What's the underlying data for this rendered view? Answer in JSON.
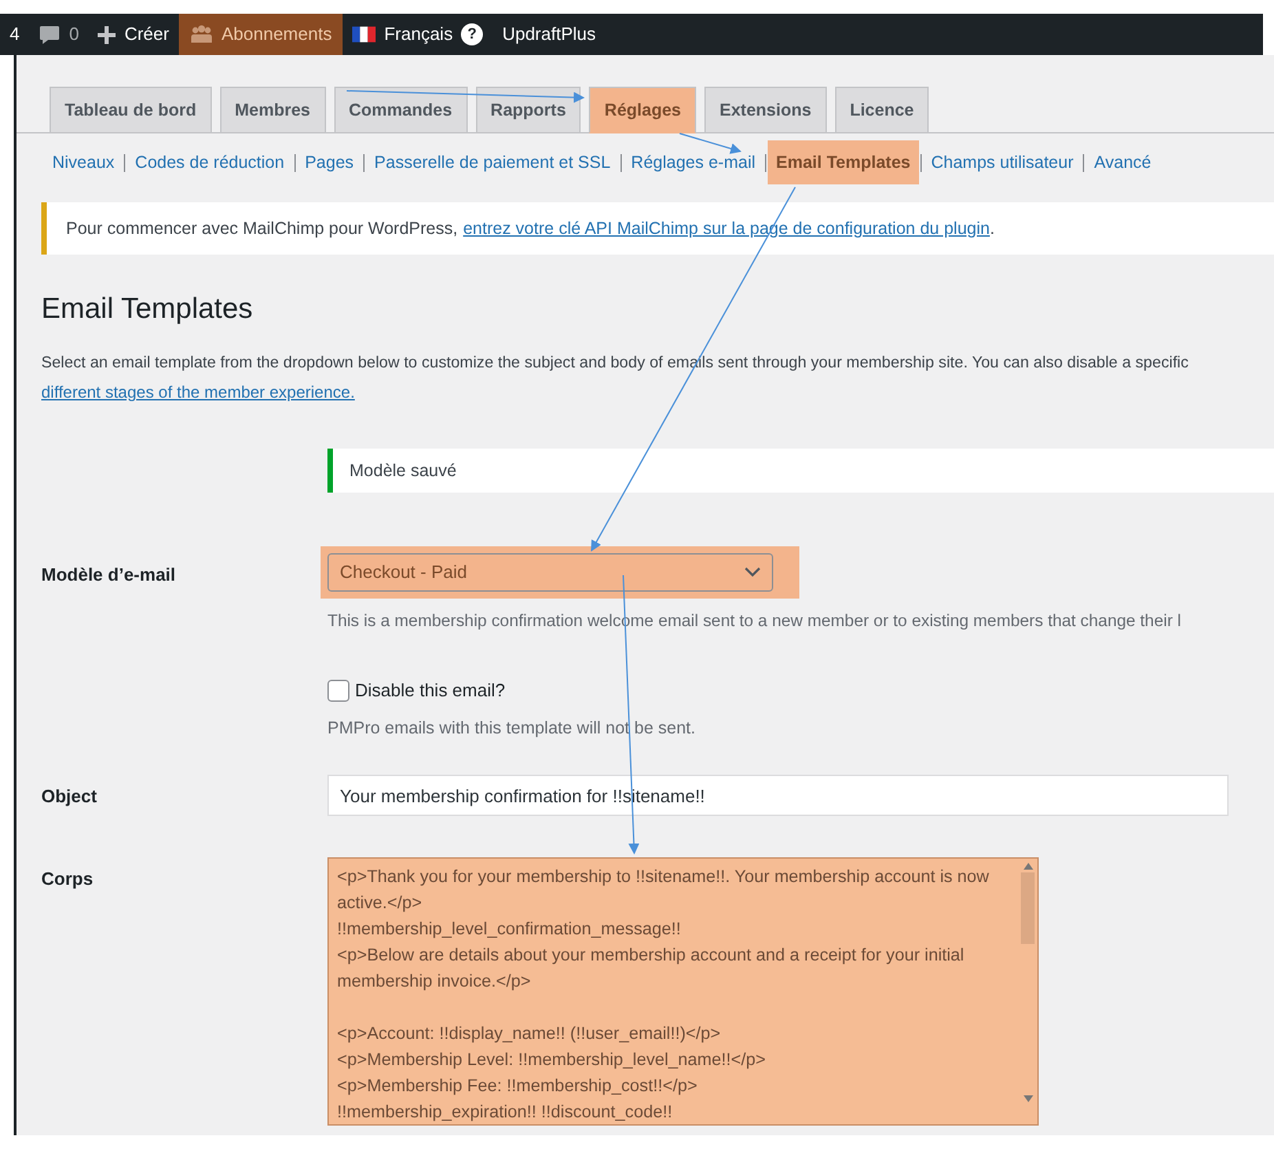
{
  "admin_bar": {
    "items": [
      {
        "kind": "text",
        "label": "4"
      },
      {
        "kind": "comments",
        "label": "0"
      },
      {
        "kind": "new",
        "label": "Créer"
      },
      {
        "kind": "members",
        "label": "Abonnements",
        "highlighted": true
      },
      {
        "kind": "language",
        "label": "Français",
        "help": "?"
      },
      {
        "kind": "text",
        "label": "UpdraftPlus"
      }
    ]
  },
  "tabs": [
    {
      "label": "Tableau de bord",
      "selected": false
    },
    {
      "label": "Membres",
      "selected": false
    },
    {
      "label": "Commandes",
      "selected": false
    },
    {
      "label": "Rapports",
      "selected": false
    },
    {
      "label": "Réglages",
      "selected": true,
      "highlighted": true
    },
    {
      "label": "Extensions",
      "selected": false
    },
    {
      "label": "Licence",
      "selected": false
    }
  ],
  "subnav": [
    {
      "label": "Niveaux",
      "selected": false
    },
    {
      "label": "Codes de réduction",
      "selected": false
    },
    {
      "label": "Pages",
      "selected": false
    },
    {
      "label": "Passerelle de paiement et SSL",
      "selected": false
    },
    {
      "label": "Réglages e-mail",
      "selected": false
    },
    {
      "label": "Email Templates",
      "selected": true,
      "highlighted": true
    },
    {
      "label": "Champs utilisateur",
      "selected": false
    },
    {
      "label": "Avancé",
      "selected": false
    }
  ],
  "notice": {
    "text": "Pour commencer avec MailChimp pour WordPress,",
    "link": "entrez votre clé API MailChimp sur la page de configuration du plugin ",
    "after": "."
  },
  "heading": "Email Templates",
  "description": {
    "text": "Select an email template from the dropdown below to customize the subject and body of emails sent through your membership site. You can also disable a specific",
    "link": "different stages of the member experience."
  },
  "saved_notice": "Modèle sauvé",
  "template": {
    "label": "Modèle d’e-mail",
    "value": "Checkout - Paid",
    "highlighted": true,
    "help": "This is a membership confirmation welcome email sent to a new member or to existing members that change their l"
  },
  "disable": {
    "label": "Disable this email?",
    "checked": false,
    "help": "PMPro emails with this template will not be sent."
  },
  "object": {
    "label": "Object",
    "value": "Your membership confirmation for !!sitename!!"
  },
  "body": {
    "label": "Corps",
    "highlighted": true,
    "value": "<p>Thank you for your membership to !!sitename!!. Your membership account is now active.</p>\n!!membership_level_confirmation_message!!\n<p>Below are details about your membership account and a receipt for your initial membership invoice.</p>\n\n<p>Account: !!display_name!! (!!user_email!!)</p>\n<p>Membership Level: !!membership_level_name!!</p>\n<p>Membership Fee: !!membership_cost!!</p>\n!!membership_expiration!! !!discount_code!!"
  }
}
